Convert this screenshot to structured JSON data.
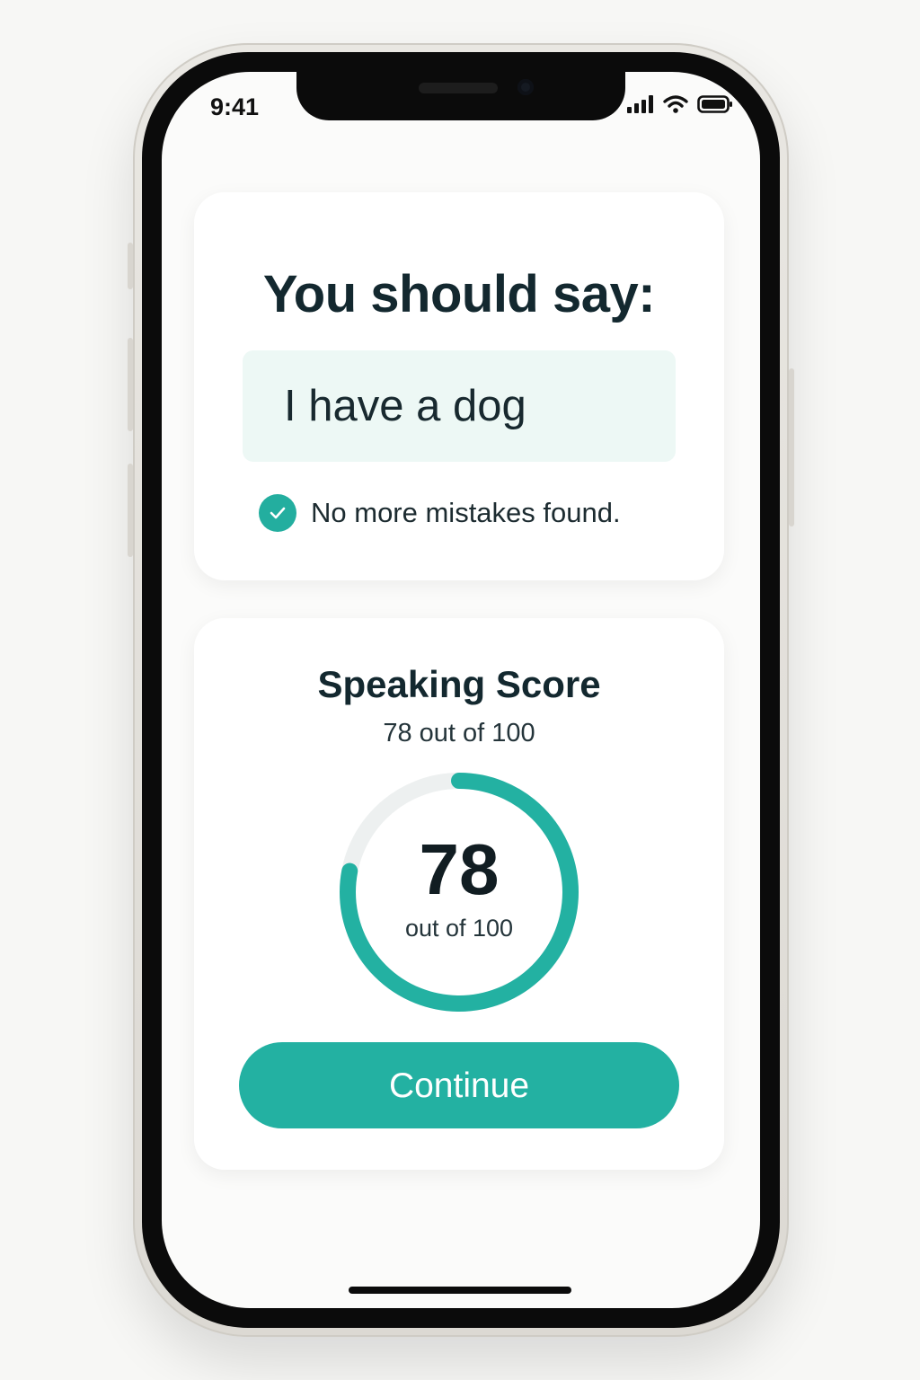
{
  "status_bar": {
    "time": "9:41",
    "signal_icon": "cellular-signal-icon",
    "wifi_icon": "wifi-icon",
    "battery_icon": "battery-icon"
  },
  "prompt_card": {
    "heading": "You should say:",
    "phrase": "I have a dog",
    "feedback_icon": "check-circle-icon",
    "feedback": "No more mistakes found."
  },
  "score_card": {
    "title": "Speaking Score",
    "subtitle": "78 out of 100",
    "score": "78",
    "score_label": "out of 100",
    "score_fraction": 0.78,
    "button_label": "Continue"
  },
  "colors": {
    "accent": "#23b1a2",
    "phrase_background": "#edf8f5",
    "track": "#edf0f0",
    "text_dark": "#13282f"
  }
}
